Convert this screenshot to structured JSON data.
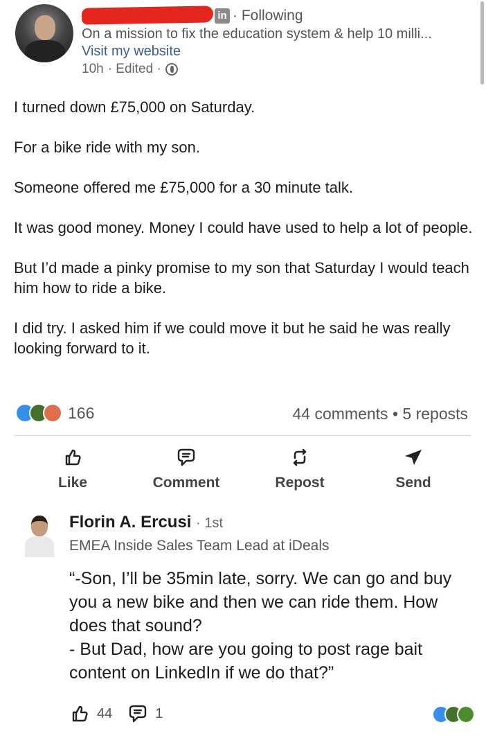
{
  "post": {
    "header": {
      "network_badge": "in",
      "follow_status": "· Following",
      "headline": "On a mission to fix the education system & help 10 milli...",
      "website_link": "Visit my website",
      "meta_time": "10h",
      "meta_edited": "· Edited ·",
      "visibility_icon": "globe-icon"
    },
    "body": [
      "I turned down £75,000 on Saturday.",
      "For a bike ride with my son.",
      "Someone offered me £75,000 for a 30 minute talk.",
      "It was good money. Money I could have used to help a lot of people.",
      "But I’d made a pinky promise to my son that Saturday I would teach him how to ride a bike.",
      "I did try. I asked him if we could move it but he said he was really looking forward to it."
    ],
    "social": {
      "reaction_icons": [
        "like-icon",
        "celebrate-icon",
        "love-icon"
      ],
      "reaction_count": "166",
      "comments_reposts": "44 comments • 5 reposts"
    },
    "actions": {
      "like": "Like",
      "comment": "Comment",
      "repost": "Repost",
      "send": "Send"
    }
  },
  "comment": {
    "author": "Florin A. Ercusi",
    "degree": "· 1st",
    "title": "EMEA Inside Sales Team Lead at iDeals",
    "lines": [
      "“-Son, I’ll be 35min late, sorry. We can go and buy you a new bike and then we can ride them. How does that sound?",
      "- But Dad, how are you going to post rage bait content on LinkedIn if we do that?”"
    ],
    "like_count": "44",
    "reply_count": "1"
  },
  "colors": {
    "link": "#3e5f8a",
    "like_reaction": "#378fe9",
    "celebrate_reaction": "#44712e",
    "love_reaction": "#df704d",
    "redaction": "#e3271e"
  }
}
